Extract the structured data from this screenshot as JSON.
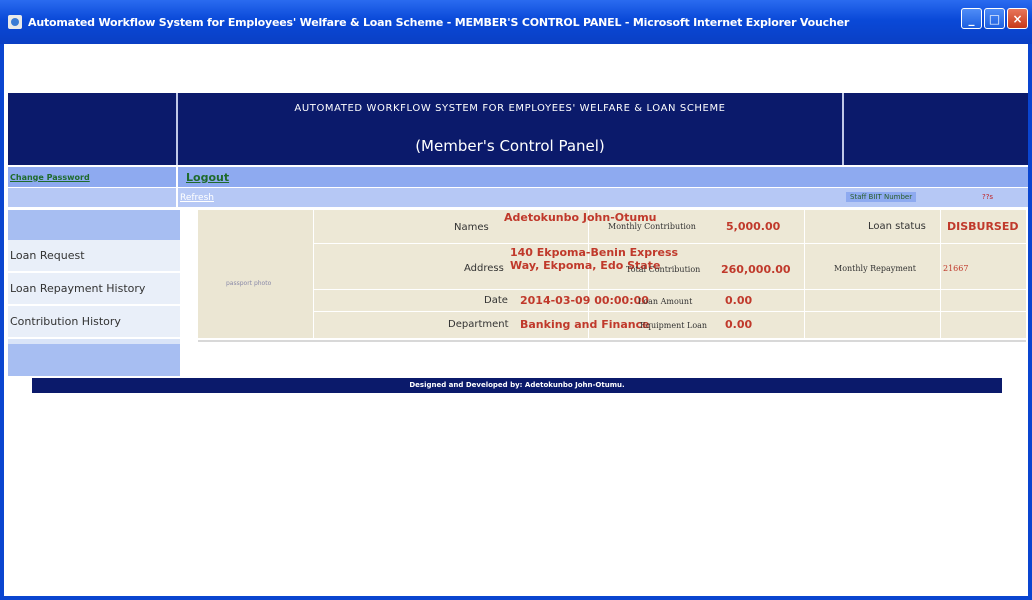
{
  "window": {
    "title": "Automated Workflow System for Employees' Welfare & Loan Scheme - MEMBER'S CONTROL PANEL - Microsoft Internet Explorer  Voucher",
    "minimize": "_",
    "maximize": "□",
    "close": "×"
  },
  "header": {
    "title": "AUTOMATED WORKFLOW SYSTEM FOR EMPLOYEES' WELFARE & LOAN SCHEME",
    "subtitle": "(Member's Control Panel)"
  },
  "nav": {
    "change_password": "Change Password",
    "logout": "Logout",
    "refresh": "Refresh",
    "staff_label": "Staff BIIT Number",
    "staff_value": "??s"
  },
  "sidebar": {
    "items": [
      {
        "label": "Loan Request"
      },
      {
        "label": "Loan Repayment History"
      },
      {
        "label": "Contribution History"
      }
    ]
  },
  "member": {
    "photo_placeholder": "passport photo",
    "names_label": "Names",
    "names_value": "Adetokunbo John-Otumu",
    "address_label": "Address",
    "address_value": "140 Ekpoma-Benin Express Way, Ekpoma, Edo State",
    "date_label": "Date",
    "date_value": "2014-03-09 00:00:00",
    "department_label": "Department",
    "department_value": "Banking and Finance",
    "monthly_contribution_label": "Monthly Contribution",
    "monthly_contribution_value": "5,000.00",
    "total_contribution_label": "Total Contribution",
    "total_contribution_value": "260,000.00",
    "loan_amount_label": "Loan Amount",
    "loan_amount_value": "0.00",
    "equipment_loan_label": "Equipment Loan",
    "equipment_loan_value": "0.00",
    "loan_status_label": "Loan status",
    "loan_status_value": "DISBURSED",
    "monthly_repayment_label": "Monthly Repayment",
    "monthly_repayment_value": "21667"
  },
  "footer": {
    "text": "Designed and Developed by: Adetokunbo John-Otumu."
  },
  "colors": {
    "title_bar": "#0a49d8",
    "header_bg": "#0b1a6b",
    "nav_bg": "#8eaaf0",
    "panel_bg": "#ede8d6",
    "value_red": "#c0392b",
    "link_green": "#1f6b2c"
  }
}
